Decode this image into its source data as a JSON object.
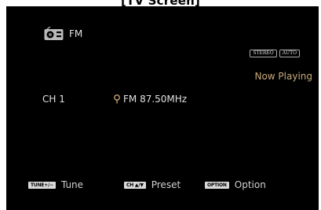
{
  "caption": "[TV Screen]",
  "header": {
    "source_icon": "radio-icon",
    "source_label": "FM"
  },
  "status": {
    "stereo_badge": "STEREO",
    "auto_badge": "AUTO",
    "now_playing": "Now Playing"
  },
  "tuner": {
    "channel": "CH 1",
    "preset_icon": "preset-pin-icon",
    "frequency": "FM 87.50MHz"
  },
  "footer": {
    "tune_key": "TUNE+/−",
    "tune_label": "Tune",
    "preset_key": "CH ▲/▼",
    "preset_label": "Preset",
    "option_key": "OPTION",
    "option_label": "Option"
  },
  "colors": {
    "screen_bg": "#000000",
    "now_playing": "#c9a979",
    "preset_icon": "#c9a979"
  }
}
